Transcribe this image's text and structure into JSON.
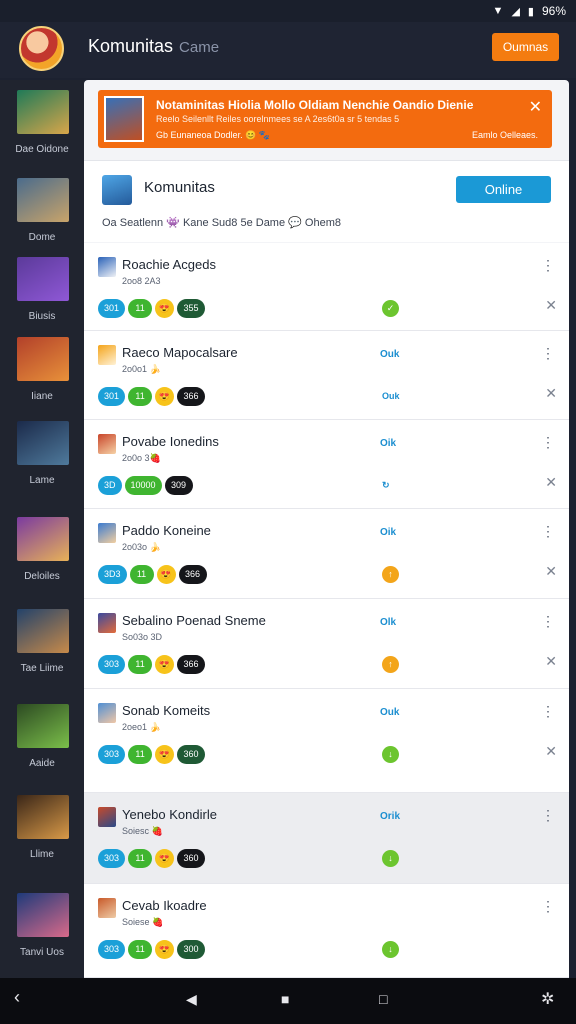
{
  "status_bar": {
    "battery": "96%"
  },
  "header": {
    "title": "Komunitas",
    "subtitle": "Came",
    "button_label": "Oumnas"
  },
  "sidebar": [
    {
      "label": "Dae Oidone",
      "colors": [
        "#1f7a58",
        "#d9a64a"
      ]
    },
    {
      "label": "Dome",
      "colors": [
        "#4a6b8c",
        "#c9a46a"
      ]
    },
    {
      "label": "Biusis",
      "colors": [
        "#5b3a9a",
        "#8f58d6"
      ]
    },
    {
      "label": "Iiane",
      "colors": [
        "#b2402a",
        "#e8913a"
      ]
    },
    {
      "label": "Lame",
      "colors": [
        "#1b2a4a",
        "#4f7a9c"
      ]
    },
    {
      "label": "Deloiles",
      "colors": [
        "#7a3aa0",
        "#e8b258"
      ]
    },
    {
      "label": "Tae Liime",
      "colors": [
        "#23426a",
        "#c78a4a"
      ]
    },
    {
      "label": "Aaide",
      "colors": [
        "#2c4a22",
        "#7bbf4a"
      ]
    },
    {
      "label": "Llime",
      "colors": [
        "#3a2618",
        "#d99a48"
      ]
    },
    {
      "label": "Tanvi Uos",
      "colors": [
        "#1e3a7a",
        "#d96a8a"
      ]
    }
  ],
  "notice": {
    "title": "Notaminitas Hiolia Mollo Oldiam Nenchie Oandio Dienie",
    "line": "Reelo Seilenllt Reiles oorelnmees se A 2es6t0a sr 5 tendas 5",
    "footer_left": "Gb Eunaneoa Dodler. 😊 🐾",
    "footer_right": "Eamlo Oelleaes.",
    "close": "✕"
  },
  "community": {
    "title": "Komunitas",
    "button_label": "Online",
    "meta": "Oa Seatlenn 👾 Kane Sud8 5e Dame 💬 Ohem8"
  },
  "rows": [
    {
      "title": "Roachie Acgeds",
      "sub": "2oo8 2A3",
      "status": "",
      "chips": [
        "301",
        "11",
        "😍",
        "355"
      ],
      "chip_styles": [
        "blue",
        "green",
        "emoji",
        "dark"
      ],
      "dot": "✓",
      "dot_color": "#6cc52f",
      "icon": [
        "#2a62b8",
        "#f0f2f6"
      ],
      "hl": false,
      "x": true
    },
    {
      "title": "Raeco Mapocalsare",
      "sub": "2o0o1 🍌",
      "status": "Ouk",
      "chips": [
        "301",
        "11",
        "😍",
        "366"
      ],
      "chip_styles": [
        "blue",
        "green",
        "emoji",
        "black"
      ],
      "dot": "Ouk",
      "dot_color": "",
      "icon": [
        "#f4a41a",
        "#fff2d6"
      ],
      "hl": false,
      "x": true
    },
    {
      "title": "Povabe Ionedins",
      "sub": "2o0o 3🍓",
      "status": "Oik",
      "chips": [
        "3D",
        "10000",
        "309"
      ],
      "chip_styles": [
        "blue",
        "green",
        "black"
      ],
      "dot": "↻",
      "dot_color": "",
      "icon": [
        "#c8452a",
        "#f6d2a6"
      ],
      "hl": false,
      "x": true
    },
    {
      "title": "Paddo Koneine",
      "sub": "2o03o 🍌",
      "status": "Oik",
      "chips": [
        "3D3",
        "11",
        "😍",
        "366"
      ],
      "chip_styles": [
        "blue",
        "green",
        "emoji",
        "black"
      ],
      "dot": "↑",
      "dot_color": "#f3a51a",
      "icon": [
        "#3b7bd0",
        "#f3cfa0"
      ],
      "hl": false,
      "x": true
    },
    {
      "title": "Sebalino Poenad Sneme",
      "sub": "So03o 3D",
      "status": "Olk",
      "chips": [
        "303",
        "11",
        "😍",
        "366"
      ],
      "chip_styles": [
        "blue",
        "green",
        "emoji",
        "black"
      ],
      "dot": "↑",
      "dot_color": "#f3a51a",
      "icon": [
        "#3a4aa0",
        "#e46b3a"
      ],
      "hl": false,
      "x": true
    },
    {
      "title": "Sonab Komeits",
      "sub": "2oeo1 🍌",
      "status": "Ouk",
      "chips": [
        "303",
        "11",
        "😍",
        "360"
      ],
      "chip_styles": [
        "blue",
        "green",
        "emoji",
        "dark"
      ],
      "dot": "↓",
      "dot_color": "#6cc52f",
      "icon": [
        "#4f8fd4",
        "#f1c7a6"
      ],
      "hl": false,
      "x": true
    },
    {
      "title": "Yenebo Kondirle",
      "sub": "Soiesc 🍓",
      "status": "Orik",
      "chips": [
        "303",
        "11",
        "😍",
        "360"
      ],
      "chip_styles": [
        "blue",
        "green",
        "emoji",
        "black"
      ],
      "dot": "↓",
      "dot_color": "#6cc52f",
      "icon": [
        "#c84a2a",
        "#2a4a8a"
      ],
      "hl": true,
      "x": false
    },
    {
      "title": "Cevab Ikoadre",
      "sub": "Soiese 🍓",
      "status": "",
      "chips": [
        "303",
        "11",
        "😍",
        "300"
      ],
      "chip_styles": [
        "blue",
        "green",
        "emoji",
        "dark"
      ],
      "dot": "↓",
      "dot_color": "#6cc52f",
      "icon": [
        "#c85a2a",
        "#eecba6"
      ],
      "hl": false,
      "x": false
    }
  ],
  "navbar": {
    "back": "‹",
    "home": "■",
    "recents": "□"
  }
}
